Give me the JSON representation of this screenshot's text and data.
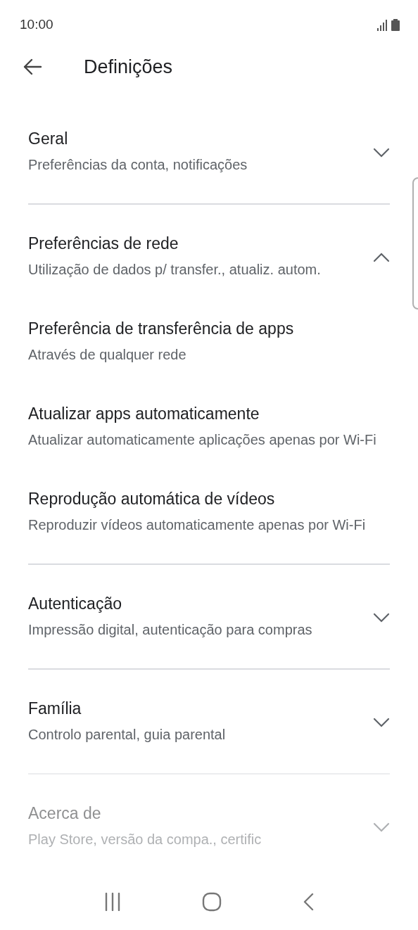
{
  "status_bar": {
    "time": "10:00"
  },
  "header": {
    "title": "Definições"
  },
  "sections": [
    {
      "title": "Geral",
      "subtitle": "Preferências da conta, notificações",
      "expanded": false
    },
    {
      "title": "Preferências de rede",
      "subtitle": "Utilização de dados p/ transfer., atualiz. autom.",
      "expanded": true,
      "children": [
        {
          "title": "Preferência de transferência de apps",
          "subtitle": "Através de qualquer rede"
        },
        {
          "title": "Atualizar apps automaticamente",
          "subtitle": "Atualizar automaticamente aplicações apenas por Wi-Fi"
        },
        {
          "title": "Reprodução automática de vídeos",
          "subtitle": "Reproduzir vídeos automaticamente apenas por Wi-Fi"
        }
      ]
    },
    {
      "title": "Autenticação",
      "subtitle": "Impressão digital, autenticação para compras",
      "expanded": false
    },
    {
      "title": "Família",
      "subtitle": "Controlo parental, guia parental",
      "expanded": false
    },
    {
      "title": "Acerca de",
      "subtitle": "Play Store, versão da compa., certific",
      "expanded": false
    }
  ]
}
